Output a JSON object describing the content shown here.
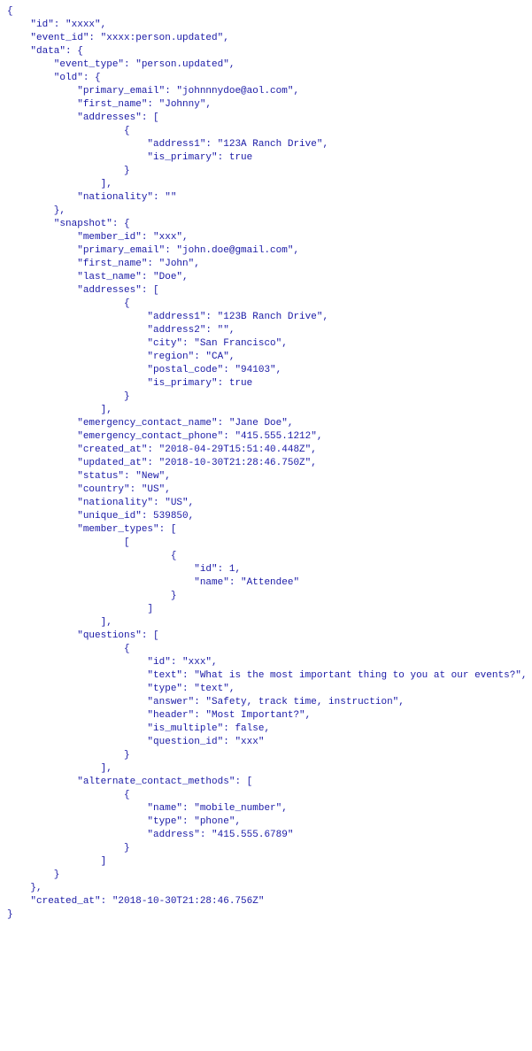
{
  "code": {
    "id": "xxxx",
    "event_id": "xxxx:person.updated",
    "data": {
      "event_type": "person.updated",
      "old": {
        "primary_email": "johnnnydoe@aol.com",
        "first_name": "Johnny",
        "addresses": [
          {
            "address1": "123A Ranch Drive",
            "is_primary": true
          }
        ],
        "nationality": ""
      },
      "snapshot": {
        "member_id": "xxx",
        "primary_email": "john.doe@gmail.com",
        "first_name": "John",
        "last_name": "Doe",
        "addresses": [
          {
            "address1": "123B Ranch Drive",
            "address2": "",
            "city": "San Francisco",
            "region": "CA",
            "postal_code": "94103",
            "is_primary": true
          }
        ],
        "emergency_contact_name": "Jane Doe",
        "emergency_contact_phone": "415.555.1212",
        "created_at": "2018-04-29T15:51:40.448Z",
        "updated_at": "2018-10-30T21:28:46.750Z",
        "status": "New",
        "country": "US",
        "nationality": "US",
        "unique_id": 539850,
        "member_types": [
          [
            {
              "id": 1,
              "name": "Attendee"
            }
          ]
        ],
        "questions": [
          {
            "id": "xxx",
            "text": "What is the most important thing to you at our events?",
            "type": "text",
            "answer": "Safety, track time, instruction",
            "header": "Most Important?",
            "is_multiple": false,
            "question_id": "xxx"
          }
        ],
        "alternate_contact_methods": [
          {
            "name": "mobile_number",
            "type": "phone",
            "address": "415.555.6789"
          }
        ]
      }
    },
    "created_at": "2018-10-30T21:28:46.756Z"
  },
  "indent_step": "    "
}
